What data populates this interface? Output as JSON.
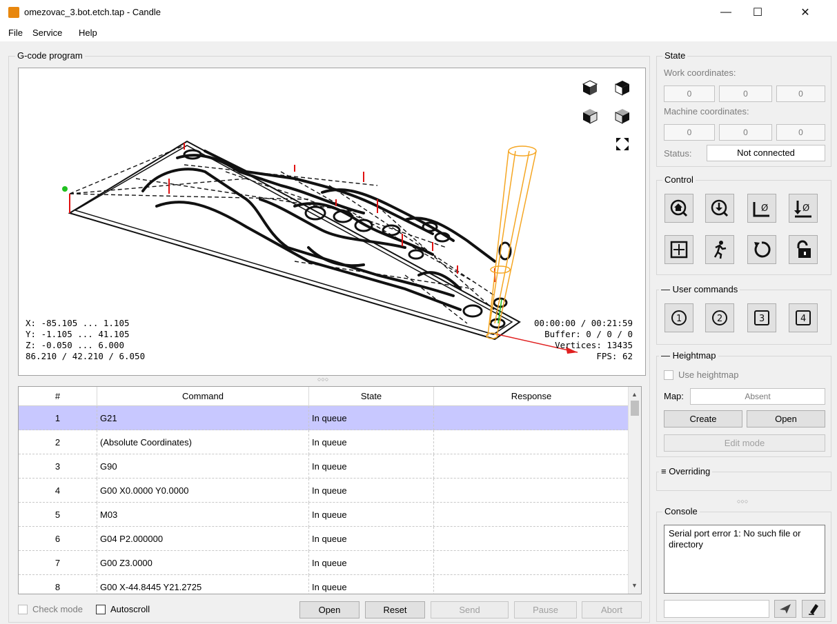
{
  "window": {
    "title": "omezovac_3.bot.etch.tap - Candle",
    "minimize": "—",
    "maximize": "☐",
    "close": "✕"
  },
  "menu": [
    "File",
    "Service",
    "Help"
  ],
  "gcode_group": {
    "title": "G-code program"
  },
  "viewport": {
    "bounds": [
      "X: -85.105 ... 1.105",
      "Y: -1.105 ... 41.105",
      "Z: -0.050 ... 6.000",
      "86.210 / 42.210 / 6.050"
    ],
    "stats": [
      "00:00:00 / 00:21:59",
      "Buffer: 0 / 0 / 0",
      "Vertices: 13435",
      "FPS: 62"
    ]
  },
  "splitter": "○○○",
  "table": {
    "headers": [
      "#",
      "Command",
      "State",
      "Response"
    ],
    "rows": [
      {
        "n": "1",
        "cmd": "G21",
        "state": "In queue",
        "resp": ""
      },
      {
        "n": "2",
        "cmd": "(Absolute Coordinates)",
        "state": "In queue",
        "resp": ""
      },
      {
        "n": "3",
        "cmd": "G90",
        "state": "In queue",
        "resp": ""
      },
      {
        "n": "4",
        "cmd": "G00 X0.0000  Y0.0000",
        "state": "In queue",
        "resp": ""
      },
      {
        "n": "5",
        "cmd": "M03",
        "state": "In queue",
        "resp": ""
      },
      {
        "n": "6",
        "cmd": "G04 P2.000000",
        "state": "In queue",
        "resp": ""
      },
      {
        "n": "7",
        "cmd": "G00 Z3.0000",
        "state": "In queue",
        "resp": ""
      },
      {
        "n": "8",
        "cmd": "G00 X-44.8445 Y21.2725",
        "state": "In queue",
        "resp": ""
      }
    ]
  },
  "bottom": {
    "check_mode": "Check mode",
    "autoscroll": "Autoscroll",
    "open": "Open",
    "reset": "Reset",
    "send": "Send",
    "pause": "Pause",
    "abort": "Abort"
  },
  "state": {
    "title": "State",
    "work_label": "Work coordinates:",
    "work": [
      "0",
      "0",
      "0"
    ],
    "machine_label": "Machine coordinates:",
    "machine": [
      "0",
      "0",
      "0"
    ],
    "status_label": "Status:",
    "status": "Not connected"
  },
  "control": {
    "title": "Control"
  },
  "user_commands": {
    "title": "User commands",
    "buttons": [
      "1",
      "2",
      "3",
      "4"
    ]
  },
  "heightmap": {
    "title": "Heightmap",
    "use": "Use heightmap",
    "map_label": "Map:",
    "map_value": "Absent",
    "create": "Create",
    "open": "Open",
    "edit_mode": "Edit mode"
  },
  "overriding": {
    "title": "Overriding"
  },
  "console": {
    "title": "Console",
    "text": "Serial port error 1: No such file or directory"
  },
  "colors": {
    "selection": "#c8c8ff",
    "tool": "#f5a623",
    "axis_x": "#e02020",
    "axis_y": "#20c020"
  }
}
